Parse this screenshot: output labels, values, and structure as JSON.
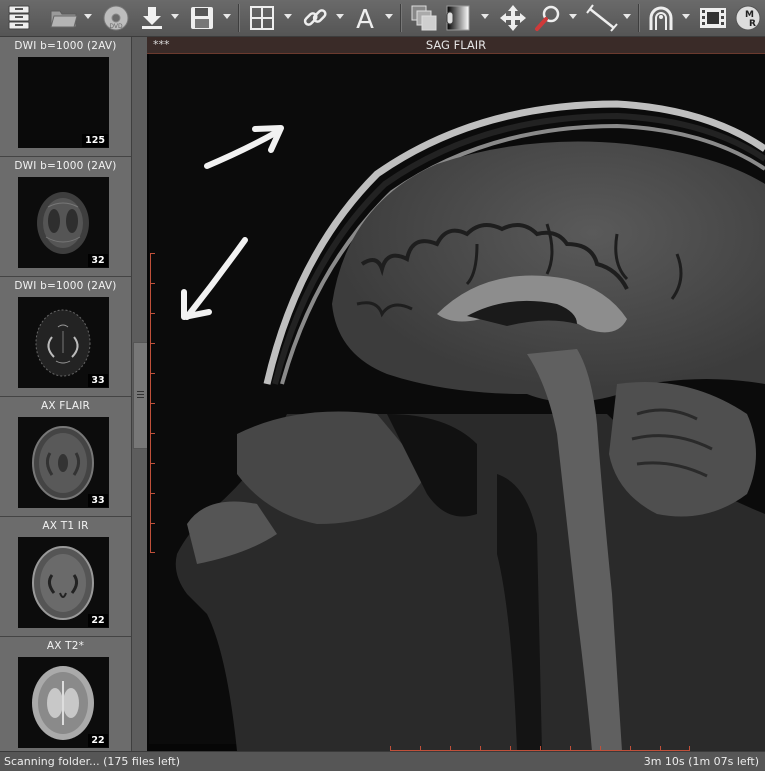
{
  "viewport": {
    "stars": "***",
    "title": "SAG FLAIR"
  },
  "series": [
    {
      "title": "DWI b=1000 (2AV)",
      "count": "125"
    },
    {
      "title": "DWI b=1000 (2AV)",
      "count": "32"
    },
    {
      "title": "DWI b=1000 (2AV)",
      "count": "33"
    },
    {
      "title": "AX FLAIR",
      "count": "33"
    },
    {
      "title": "AX T1 IR",
      "count": "22"
    },
    {
      "title": "AX T2*",
      "count": "22"
    }
  ],
  "status": {
    "left": "Scanning folder... (175 files left)",
    "right": "3m 10s (1m 07s left)"
  },
  "icons": {
    "toolbar": [
      "database-icon",
      "open-folder-icon",
      "cd-dvd-icon",
      "import-icon",
      "save-icon",
      "layout-icon",
      "sync-link-icon",
      "text-annotation-icon",
      "stack-icon",
      "window-level-icon",
      "pan-icon",
      "zoom-icon",
      "measure-icon",
      "3d-render-icon",
      "movie-export-icon",
      "mpr-icon"
    ]
  },
  "colors": {
    "header_bg": "#3a2b28",
    "ruler": "#c0503a",
    "panel": "#696969"
  }
}
